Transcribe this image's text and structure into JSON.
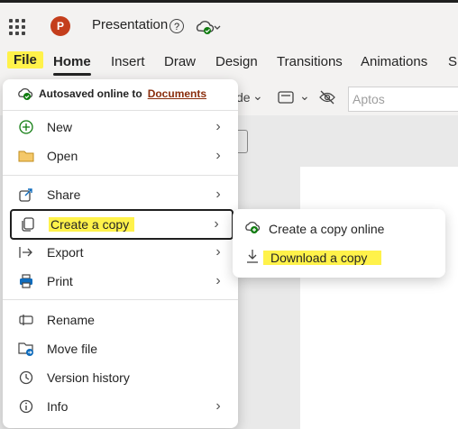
{
  "header": {
    "app_logo": "P",
    "title": "Presentation",
    "shield_symbol": "?"
  },
  "ribbon": {
    "tabs": [
      "File",
      "Home",
      "Insert",
      "Draw",
      "Design",
      "Transitions",
      "Animations",
      "Sl"
    ]
  },
  "toolbar": {
    "partial_label": "de",
    "font_placeholder": "Aptos"
  },
  "file_menu": {
    "autosave_text": "Autosaved online to",
    "autosave_link": "Documents",
    "items": [
      {
        "label": "New",
        "icon": "plus-circle-icon"
      },
      {
        "label": "Open",
        "icon": "folder-icon"
      },
      {
        "label": "Share",
        "icon": "share-icon"
      },
      {
        "label": "Create a copy",
        "icon": "copy-icon"
      },
      {
        "label": "Export",
        "icon": "export-icon"
      },
      {
        "label": "Print",
        "icon": "printer-icon"
      },
      {
        "label": "Rename",
        "icon": "rename-icon"
      },
      {
        "label": "Move file",
        "icon": "move-folder-icon"
      },
      {
        "label": "Version history",
        "icon": "clock-icon"
      },
      {
        "label": "Info",
        "icon": "info-icon"
      }
    ]
  },
  "copy_submenu": {
    "items": [
      {
        "label": "Create a copy online",
        "icon": "cloud-add-icon"
      },
      {
        "label": "Download a copy",
        "icon": "download-icon"
      }
    ]
  },
  "highlight_color": "#fff24a",
  "brand_color": "#c43e1c"
}
